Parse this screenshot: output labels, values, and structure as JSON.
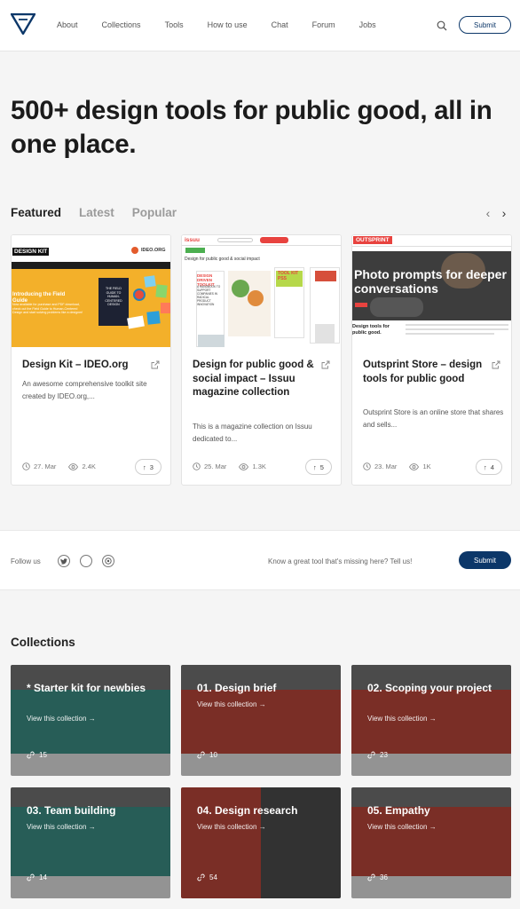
{
  "nav": {
    "items": [
      "About",
      "Collections",
      "Tools",
      "How to use",
      "Chat",
      "Forum",
      "Jobs"
    ],
    "submit_label": "Submit"
  },
  "hero": {
    "title": "500+ design tools for public good, all in one place."
  },
  "tabs": [
    "Featured",
    "Latest",
    "Popular"
  ],
  "cards": [
    {
      "title": "Design Kit – IDEO.org",
      "description": "An awesome comprehensive toolkit site created by IDEO.org,...",
      "date": "27. Mar",
      "views": "2.4K",
      "upvotes": "3",
      "thumb": {
        "brand": "DESIGN KIT",
        "org": "IDEO.ORG",
        "banner": "Introducing the Field Guide",
        "sub": "Now available for purchase and PDF download, check out the Field Guide to Human-Centered Design and start solving problems like a designer!",
        "book": "THE FIELD GUIDE TO HUMAN-CENTERED DESIGN"
      }
    },
    {
      "title": "Design for public good & social impact – Issuu magazine collection",
      "description": "This is a magazine collection on Issuu dedicated to...",
      "date": "25. Mar",
      "views": "1.3K",
      "upvotes": "5",
      "thumb": {
        "brand": "issuu",
        "heading": "Design for public good & social impact",
        "mag1": "DESIGN DRIVEN TOOLKIT",
        "mag2": "TOOL KIT PSS",
        "mag3": "A HANDBOOK TO SUPPORT COMPANIES IN RADICAL PRODUCT INNOVATION"
      }
    },
    {
      "title": "Outsprint Store – design tools for public good",
      "description": "Outsprint Store is an online store that shares and sells...",
      "date": "23. Mar",
      "views": "1K",
      "upvotes": "4",
      "thumb": {
        "brand": "OUTSPRINT",
        "banner": "Photo prompts for deeper conversations",
        "sub": "Design tools for public good."
      }
    }
  ],
  "follow": {
    "label": "Follow us",
    "icons": [
      "twitter-icon",
      "instagram-icon",
      "dribbble-icon"
    ],
    "tell": "Know a great tool that's missing here? Tell us!",
    "submit_label": "Submit"
  },
  "collections": {
    "title": "Collections",
    "link_label": "View this collection",
    "items": [
      {
        "title": "* Starter kit for newbies",
        "count": "15",
        "color": "#3a8a80"
      },
      {
        "title": "01. Design brief",
        "count": "10",
        "color": "#b44538"
      },
      {
        "title": "02. Scoping your project",
        "count": "23",
        "color": "#b44538"
      },
      {
        "title": "03. Team building",
        "count": "14",
        "color": "#3a8a80"
      },
      {
        "title": "04. Design research",
        "count": "54",
        "color": "#b44538"
      },
      {
        "title": "05. Empathy",
        "count": "36",
        "color": "#b44538"
      }
    ]
  },
  "colors": {
    "navy": "#0c3769",
    "teal": "#3a8a80",
    "red": "#b44538"
  }
}
